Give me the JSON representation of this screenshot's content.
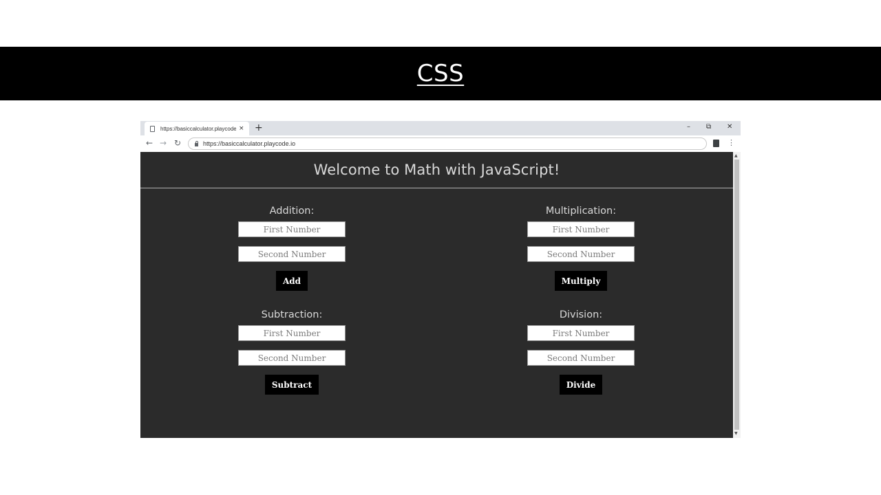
{
  "slide": {
    "title": "CSS"
  },
  "browser": {
    "tab_title": "https://basiccalculator.playcode.i",
    "tab_close": "×",
    "new_tab": "+",
    "controls": {
      "minimize": "–",
      "restore": "⧉",
      "close": "✕"
    },
    "nav": {
      "back": "←",
      "forward": "→",
      "reload": "↻",
      "menu": "⋮"
    },
    "url": "https://basiccalculator.playcode.io"
  },
  "page": {
    "title": "Welcome to Math with JavaScript!",
    "addition": {
      "label": "Addition:",
      "first_placeholder": "First Number",
      "second_placeholder": "Second Number",
      "button": "Add"
    },
    "multiplication": {
      "label": "Multiplication:",
      "first_placeholder": "First Number",
      "second_placeholder": "Second Number",
      "button": "Multiply"
    },
    "subtraction": {
      "label": "Subtraction:",
      "first_placeholder": "First Number",
      "second_placeholder": "Second Number",
      "button": "Subtract"
    },
    "division": {
      "label": "Division:",
      "first_placeholder": "First Number",
      "second_placeholder": "Second Number",
      "button": "Divide"
    }
  },
  "colors": {
    "banner": "#000000",
    "page_background": "#2b2b2b",
    "page_text": "#d9d9d9",
    "button_background": "#000000"
  },
  "icons": {
    "tab_page": "page-icon",
    "lock": "lock-icon",
    "extension": "clipboard-icon"
  }
}
